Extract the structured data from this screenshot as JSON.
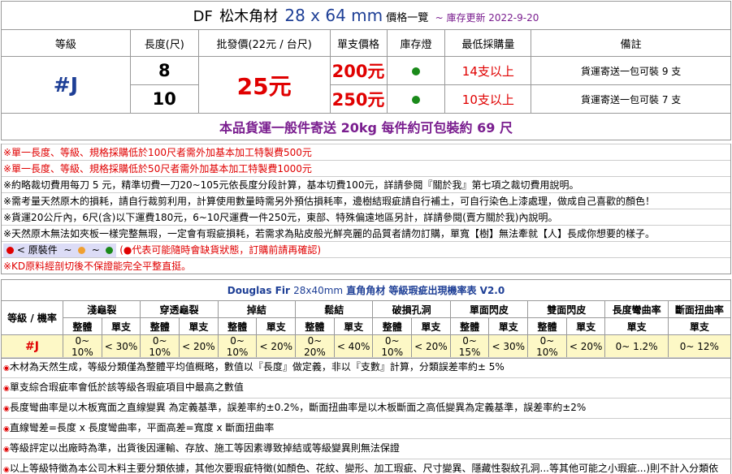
{
  "header": {
    "prefix": "DF",
    "product": "松木角材",
    "size": "28 x 64 mm",
    "price_list": "價格一覽",
    "updated": "~ 庫存更新 2022-9-20"
  },
  "columns": [
    "等級",
    "長度(尺)",
    "批發價(22元 / 台尺)",
    "單支價格",
    "庫存燈",
    "最低採購量",
    "備註"
  ],
  "grade": "#J",
  "wholesale_price": "25元",
  "rows": [
    {
      "length": "8",
      "unit_price": "200元",
      "stock_color": "#1a8a1a",
      "min_buy": "14支以上",
      "note": "貨運寄送一包可裝 9 支"
    },
    {
      "length": "10",
      "unit_price": "250元",
      "stock_color": "#1a8a1a",
      "min_buy": "10支以上",
      "note": "貨運寄送一包可裝 7 支"
    }
  ],
  "shipping": "本品貨運一般件寄送 20kg 每件約可包裝約 69 尺",
  "notes1": [
    "※單一長度、等級、規格採購低於100尺者需外加基本加工特製費500元",
    "※單一長度、等級、規格採購低於50尺者需外加基本加工特製費1000元",
    "※約略裁切費用每刀 5 元，精準切費一刀20~105元依長度分段計算，基本切費100元，詳請參閱『關於我』第七項之裁切費用說明。",
    "※需考量天然原木的損耗，請自行裁剪利用，計算使用數量時需另外預估損耗率，邊樹結瑕疵請自行補土，可自行染色上漆處理，做成自己喜歡的顏色！",
    "※貨運20公斤內，6尺(含)以下運費180元，6~10尺運費一件250元，東部、特殊偏遠地區另計，詳請參閱(賣方關於我)內說明。",
    "※天然原木無法如夾板一樣完整無瑕，一定會有瑕疵損耗，若需求為貼皮般光鮮亮麗的品質者請勿訂購，單寬【樹】無法牽就【人】長成你想要的樣子。"
  ],
  "legend": {
    "label": "< 原裝件",
    "tilde": "~",
    "dot_colors": [
      "#e00000",
      "#f0a030",
      "#1a8a1a"
    ],
    "note": "(●代表可能隨時會缺貨狀態，訂購前請再確認)"
  },
  "notes1_last": "※KD原料經剖切後不保證能完全平整直挺。",
  "defect": {
    "title_prefix": "Douglas Fir",
    "title_size": "28x40mm",
    "title_rest": "直角角材 等級瑕疵出現機率表 V2.0",
    "row_header": "等級 / 機率",
    "groups": [
      "淺龜裂",
      "穿透龜裂",
      "掉結",
      "鬆結",
      "破損孔洞",
      "單面閃皮",
      "雙面閃皮",
      "長度彎曲率",
      "斷面扭曲率"
    ],
    "sub_whole": "整體",
    "sub_single": "單支",
    "grade": "#J",
    "values": [
      "0~ 10%",
      "< 30%",
      "0~ 10%",
      "< 20%",
      "0~ 10%",
      "< 20%",
      "0~ 20%",
      "< 40%",
      "0~ 10%",
      "< 20%",
      "0~ 15%",
      "< 30%",
      "0~ 10%",
      "< 20%",
      "0~ 1.2%",
      "0~ 12%"
    ]
  },
  "notes2": [
    "木材為天然生成，等級分類僅為整體平均值概略，數值以『長度』做定義，非以『支數』計算，分類誤差率約± 5%",
    "單支綜合瑕疵率會低於該等級各瑕疵項目中最高之數值",
    "長度彎曲率是以木板寬面之直線變異 為定義基準，誤差率約±0.2%，斷面扭曲率是以木板斷面之高低變異為定義基準，誤差率約±2%",
    "直線彎差=長度 x 長度彎曲率，平面高差=寬度 x 斷面扭曲率",
    "等級評定以出廠時為準，出貨後因運輸、存放、施工等因素導致掉結或等級變異則無法保證",
    "以上等級特徵為本公司木料主要分類依據，其他次要瑕疵特徵(如顏色、花紋、變形、加工瑕疵、尺寸變異、隱藏性裂紋孔洞...等其他可能之小瑕疵...)則不計入分類依據，次要瑕疵程度通常會隨等級降低而增加"
  ]
}
